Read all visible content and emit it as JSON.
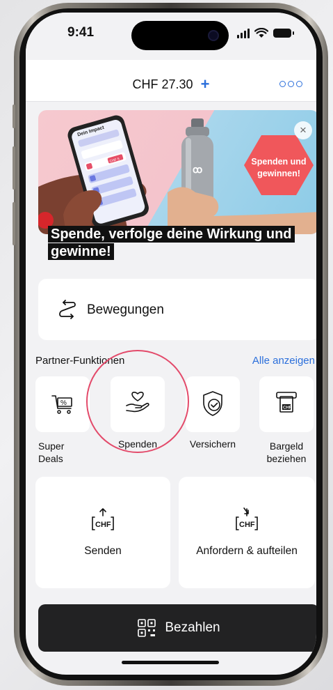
{
  "status_bar": {
    "time": "9:41"
  },
  "header": {
    "balance": "CHF 27.30",
    "add_symbol": "+"
  },
  "banner": {
    "phone_label": "Dein Impact",
    "phone_tag": "CHF 5",
    "hex_line1": "Spenden und",
    "hex_line2": "gewinnen!",
    "close_symbol": "×",
    "caption": "Spende, verfolge deine Wirkung und gewinne!"
  },
  "movements": {
    "label": "Bewegungen"
  },
  "partner_section": {
    "title": "Partner-Funktionen",
    "show_all": "Alle anzeigen",
    "items": [
      {
        "label": "Super\nDeals",
        "icon": "cart-percent-icon"
      },
      {
        "label": "Spenden",
        "icon": "hand-heart-icon"
      },
      {
        "label": "Versichern",
        "icon": "shield-check-icon"
      },
      {
        "label": "Bargeld\nbeziehen",
        "icon": "atm-cash-icon"
      }
    ]
  },
  "actions": [
    {
      "label": "Senden",
      "currency": "CHF",
      "icon": "send-chf-icon"
    },
    {
      "label": "Anfordern & aufteilen",
      "currency": "CHF",
      "icon": "request-chf-icon"
    }
  ],
  "pay_button": {
    "label": "Bezahlen",
    "icon": "qr-code-icon"
  },
  "colors": {
    "accent": "#2b6fdb",
    "highlight": "#e34a6a",
    "pay_button": "#222223",
    "banner_pink": "#f6c9cf",
    "banner_blue": "#8ccbe7",
    "hex_red": "#f0575b"
  }
}
